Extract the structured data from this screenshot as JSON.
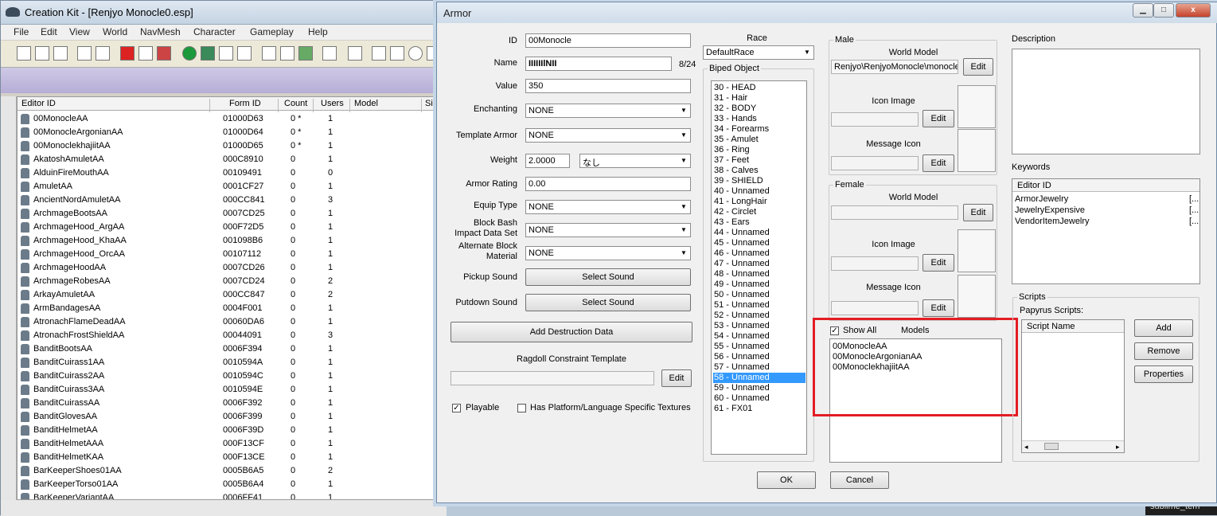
{
  "app": {
    "title": "Creation Kit - [Renjyo Monocle0.esp]"
  },
  "menu": [
    "File",
    "Edit",
    "View",
    "World",
    "NavMesh",
    "Character",
    "Gameplay",
    "Help"
  ],
  "list": {
    "columns": [
      "Editor ID",
      "Form ID",
      "Count",
      "Users",
      "Model",
      "Siz"
    ],
    "rows": [
      {
        "id": "00MonocleAA",
        "form": "01000D63",
        "count": "0 *",
        "users": "1"
      },
      {
        "id": "00MonocleArgonianAA",
        "form": "01000D64",
        "count": "0 *",
        "users": "1"
      },
      {
        "id": "00MonoclekhajiitAA",
        "form": "01000D65",
        "count": "0 *",
        "users": "1"
      },
      {
        "id": "AkatoshAmuletAA",
        "form": "000C8910",
        "count": "0",
        "users": "1"
      },
      {
        "id": "AlduinFireMouthAA",
        "form": "00109491",
        "count": "0",
        "users": "0"
      },
      {
        "id": "AmuletAA",
        "form": "0001CF27",
        "count": "0",
        "users": "1"
      },
      {
        "id": "AncientNordAmuletAA",
        "form": "000CC841",
        "count": "0",
        "users": "3"
      },
      {
        "id": "ArchmageBootsAA",
        "form": "0007CD25",
        "count": "0",
        "users": "1"
      },
      {
        "id": "ArchmageHood_ArgAA",
        "form": "000F72D5",
        "count": "0",
        "users": "1"
      },
      {
        "id": "ArchmageHood_KhaAA",
        "form": "001098B6",
        "count": "0",
        "users": "1"
      },
      {
        "id": "ArchmageHood_OrcAA",
        "form": "00107112",
        "count": "0",
        "users": "1"
      },
      {
        "id": "ArchmageHoodAA",
        "form": "0007CD26",
        "count": "0",
        "users": "1"
      },
      {
        "id": "ArchmageRobesAA",
        "form": "0007CD24",
        "count": "0",
        "users": "2"
      },
      {
        "id": "ArkayAmuletAA",
        "form": "000CC847",
        "count": "0",
        "users": "2"
      },
      {
        "id": "ArmBandagesAA",
        "form": "0004F001",
        "count": "0",
        "users": "1"
      },
      {
        "id": "AtronachFlameDeadAA",
        "form": "00060DA6",
        "count": "0",
        "users": "1"
      },
      {
        "id": "AtronachFrostShieldAA",
        "form": "00044091",
        "count": "0",
        "users": "3"
      },
      {
        "id": "BanditBootsAA",
        "form": "0006F394",
        "count": "0",
        "users": "1"
      },
      {
        "id": "BanditCuirass1AA",
        "form": "0010594A",
        "count": "0",
        "users": "1"
      },
      {
        "id": "BanditCuirass2AA",
        "form": "0010594C",
        "count": "0",
        "users": "1"
      },
      {
        "id": "BanditCuirass3AA",
        "form": "0010594E",
        "count": "0",
        "users": "1"
      },
      {
        "id": "BanditCuirassAA",
        "form": "0006F392",
        "count": "0",
        "users": "1"
      },
      {
        "id": "BanditGlovesAA",
        "form": "0006F399",
        "count": "0",
        "users": "1"
      },
      {
        "id": "BanditHelmetAA",
        "form": "0006F39D",
        "count": "0",
        "users": "1"
      },
      {
        "id": "BanditHelmetAAA",
        "form": "000F13CF",
        "count": "0",
        "users": "1"
      },
      {
        "id": "BanditHelmetKAA",
        "form": "000F13CE",
        "count": "0",
        "users": "1"
      },
      {
        "id": "BarKeeperShoes01AA",
        "form": "0005B6A5",
        "count": "0",
        "users": "2"
      },
      {
        "id": "BarKeeperTorso01AA",
        "form": "0005B6A4",
        "count": "0",
        "users": "1"
      },
      {
        "id": "BarKeeperVariantAA",
        "form": "0006FF41",
        "count": "0",
        "users": "1"
      }
    ]
  },
  "armor": {
    "title": "Armor",
    "fields": {
      "id_label": "ID",
      "id_value": "00Monocle",
      "name_label": "Name",
      "name_value": "IIIIIIlNII",
      "name_count": "8/24",
      "value_label": "Value",
      "value_value": "350",
      "enchanting_label": "Enchanting",
      "enchanting_value": "NONE",
      "template_label": "Template Armor",
      "template_value": "NONE",
      "weight_label": "Weight",
      "weight_value": "2.0000",
      "weight_unit": "なし",
      "rating_label": "Armor Rating",
      "rating_value": "0.00",
      "equip_label": "Equip Type",
      "equip_value": "NONE",
      "bash_label1": "Block Bash",
      "bash_label2": "Impact Data Set",
      "bash_value": "NONE",
      "alt_label1": "Alternate Block",
      "alt_label2": "Material",
      "alt_value": "NONE",
      "pickup_label": "Pickup Sound",
      "putdown_label": "Putdown Sound",
      "select_sound": "Select Sound",
      "add_destruction": "Add Destruction Data",
      "ragdoll_label": "Ragdoll Constraint Template",
      "edit": "Edit",
      "playable": "Playable",
      "platform": "Has Platform/Language Specific Textures"
    },
    "race": {
      "label": "Race",
      "value": "DefaultRace"
    },
    "biped": {
      "label": "Biped Object",
      "items": [
        "30 - HEAD",
        "31 - Hair",
        "32 - BODY",
        "33 - Hands",
        "34 - Forearms",
        "35 - Amulet",
        "36 - Ring",
        "37 - Feet",
        "38 - Calves",
        "39 - SHIELD",
        "40 - Unnamed",
        "41 - LongHair",
        "42 - Circlet",
        "43 - Ears",
        "44 - Unnamed",
        "45 - Unnamed",
        "46 - Unnamed",
        "47 - Unnamed",
        "48 - Unnamed",
        "49 - Unnamed",
        "50 - Unnamed",
        "51 - Unnamed",
        "52 - Unnamed",
        "53 - Unnamed",
        "54 - Unnamed",
        "55 - Unnamed",
        "56 - Unnamed",
        "57 - Unnamed",
        "58 - Unnamed",
        "59 - Unnamed",
        "60 - Unnamed",
        "61 - FX01"
      ],
      "selected_index": 28
    },
    "male": {
      "label": "Male",
      "world_model": "World Model",
      "world_model_path": "Renjyo\\RenjyoMonocle\\monocle",
      "icon_image": "Icon Image",
      "message_icon": "Message Icon"
    },
    "female": {
      "label": "Female",
      "world_model": "World Model",
      "icon_image": "Icon Image",
      "message_icon": "Message Icon"
    },
    "models": {
      "show_all": "Show All",
      "label": "Models",
      "items": [
        "00MonocleAA",
        "00MonocleArgonianAA",
        "00MonoclekhajiitAA"
      ]
    },
    "description_label": "Description",
    "keywords": {
      "label": "Keywords",
      "col": "Editor ID",
      "items": [
        "ArmorJewelry",
        "JewelryExpensive",
        "VendorItemJewelry"
      ],
      "suffix": "[..."
    },
    "scripts": {
      "label": "Scripts",
      "papyrus": "Papyrus Scripts:",
      "col": "Script Name",
      "add": "Add",
      "remove": "Remove",
      "properties": "Properties"
    },
    "ok": "OK",
    "cancel": "Cancel"
  },
  "taskbar_text": "sublime_tem",
  "colors": {
    "highlight": "#e31d24",
    "selection": "#3399ff"
  }
}
